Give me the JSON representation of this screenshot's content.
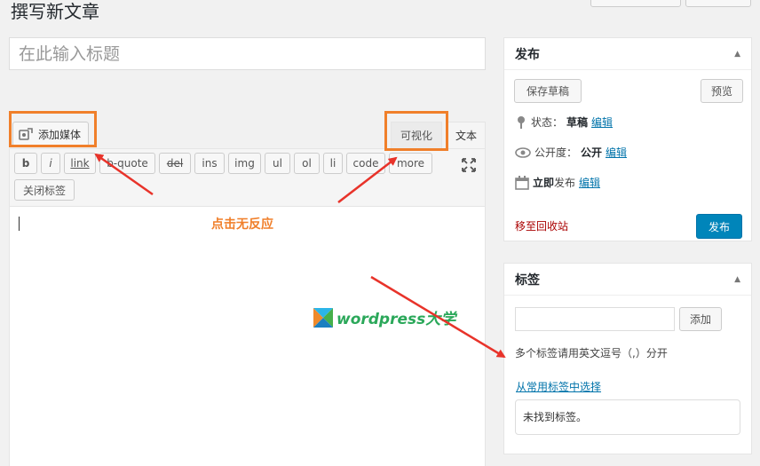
{
  "page": {
    "title": "撰写新文章",
    "title_placeholder": "在此输入标题"
  },
  "editor": {
    "add_media_label": "添加媒体",
    "tabs": {
      "visual": "可视化",
      "text": "文本"
    },
    "quicktags": [
      "b",
      "i",
      "link",
      "b-quote",
      "del",
      "ins",
      "img",
      "ul",
      "ol",
      "li",
      "code",
      "more"
    ],
    "close_tags_label": "关闭标签",
    "watermark": "wordpress大学"
  },
  "annotation": {
    "note": "点击无反应",
    "color": "#f07f2a",
    "arrow_color": "#e8332a"
  },
  "publish_box": {
    "title": "发布",
    "save_draft": "保存草稿",
    "preview": "预览",
    "status_label": "状态：",
    "status_value": "草稿",
    "visibility_label": "公开度：",
    "visibility_value": "公开",
    "schedule_bold": "立即",
    "schedule_text": "发布",
    "edit_link": "编辑",
    "trash_link": "移至回收站",
    "publish_button": "发布",
    "publish_color": "#0085ba"
  },
  "tags_box": {
    "title": "标签",
    "add_button": "添加",
    "hint": "多个标签请用英文逗号（,）分开",
    "choose_common": "从常用标签中选择",
    "no_tags": "未找到标签。"
  }
}
